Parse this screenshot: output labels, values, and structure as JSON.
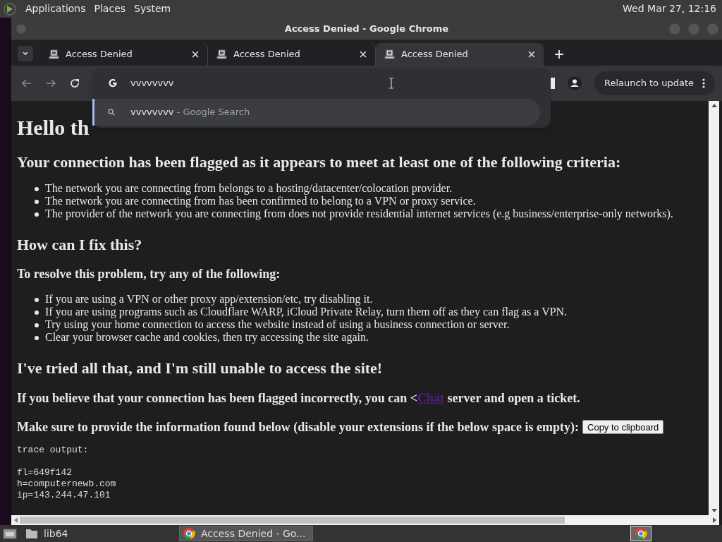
{
  "panel": {
    "menus": [
      "Applications",
      "Places",
      "System"
    ],
    "clock": "Wed Mar 27, 12:16"
  },
  "window": {
    "title": "Access Denied - Google Chrome"
  },
  "tabs": [
    {
      "title": "Access Denied",
      "selected": false
    },
    {
      "title": "Access Denied",
      "selected": false
    },
    {
      "title": "Access Denied",
      "selected": true
    }
  ],
  "toolbar": {
    "relaunch": "Relaunch to update"
  },
  "omnibox": {
    "value": "vvvvvvvv",
    "suggestion": {
      "query": "vvvvvvvv",
      "suffix": " - Google Search"
    }
  },
  "page": {
    "heading": "Hello th",
    "subheading": "Your connection has been flagged as it appears to meet at least one of the following criteria:",
    "criteria": [
      "The network you are connecting from belongs to a hosting/datacenter/colocation provider.",
      "The network you are connecting from has been confirmed to belong to a VPN or proxy service.",
      "The provider of the network you are connecting from does not provide residential internet services (e.g business/enterprise-only networks)."
    ],
    "fix_heading": "How can I fix this?",
    "fix_intro": "To resolve this problem, try any of the following:",
    "steps": [
      "If you are using a VPN or other proxy app/extension/etc, try disabling it.",
      "If you are using programs such as Cloudflare WARP, iCloud Private Relay, turn them off as they can flag as a VPN.",
      "Try using your home connection to access the website instead of using a business connection or server.",
      "Clear your browser cache and cookies, then try accessing the site again."
    ],
    "tried_heading": "I've tried all that, and I'm still unable to access the site!",
    "contact": {
      "before": "If you believe that your connection has been flagged incorrectly, you can <",
      "link": "Chat",
      "after": " server and open a ticket."
    },
    "provide": "Make sure to provide the information found below (disable your extensions if the below space is empty):",
    "copy_button": "Copy to clipboard",
    "trace": [
      "trace output:",
      "fl=649f142",
      "h=computernewb.com",
      "ip=143.244.47.101"
    ]
  },
  "taskbar": [
    {
      "label": "lib64",
      "kind": "folder",
      "selected": false
    },
    {
      "label": "Access Denied - Go...",
      "kind": "browser",
      "selected": true
    }
  ]
}
